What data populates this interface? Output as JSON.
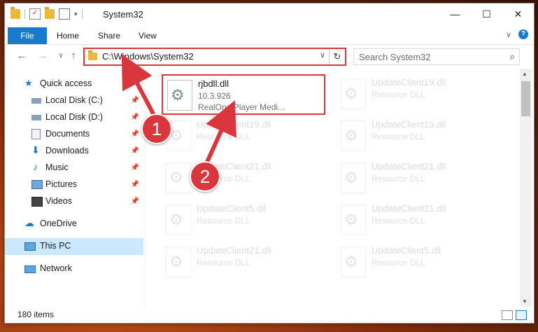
{
  "window": {
    "title": "System32",
    "minimize_glyph": "—",
    "maximize_glyph": "☐",
    "close_glyph": "✕"
  },
  "ribbon": {
    "tabs": [
      "File",
      "Home",
      "Share",
      "View"
    ],
    "expand_glyph": "∨",
    "help_glyph": "?"
  },
  "navigation": {
    "back_glyph": "←",
    "forward_glyph": "→",
    "recent_glyph": "∨",
    "up_glyph": "↑",
    "address": "C:\\Windows\\System32",
    "dropdown_glyph": "∨",
    "refresh_glyph": "↻",
    "search_placeholder": "Search System32",
    "search_glyph": "⌕"
  },
  "sidebar": {
    "items": [
      {
        "label": "Quick access",
        "icon": "star-icon",
        "pinned": false
      },
      {
        "label": "Local Disk (C:)",
        "icon": "drive-icon",
        "pinned": true
      },
      {
        "label": "Local Disk (D:)",
        "icon": "drive-icon",
        "pinned": true
      },
      {
        "label": "Documents",
        "icon": "documents-icon",
        "pinned": true
      },
      {
        "label": "Downloads",
        "icon": "download-icon",
        "pinned": true
      },
      {
        "label": "Music",
        "icon": "music-icon",
        "pinned": true
      },
      {
        "label": "Pictures",
        "icon": "pictures-icon",
        "pinned": true
      },
      {
        "label": "Videos",
        "icon": "videos-icon",
        "pinned": true
      },
      {
        "label": "OneDrive",
        "icon": "cloud-icon",
        "pinned": false
      },
      {
        "label": "This PC",
        "icon": "computer-icon",
        "pinned": false,
        "selected": true
      },
      {
        "label": "Network",
        "icon": "network-icon",
        "pinned": false
      }
    ],
    "pin_glyph": "📌"
  },
  "files": {
    "selected": {
      "name": "rjbdll.dll",
      "version": "10.3.926",
      "description": "RealOne Player Medi..."
    },
    "faded": [
      {
        "name": "UpdateClient19.dll",
        "type": "Resource DLL"
      },
      {
        "name": "UpdateClient19.dll",
        "type": "Resource DLL"
      },
      {
        "name": "UpdateClient19.dll",
        "type": "Resource DLL"
      },
      {
        "name": "UpdateClient21.dll",
        "type": "Resource DLL"
      },
      {
        "name": "UpdateClient21.dll",
        "type": "Resource DLL"
      },
      {
        "name": "UpdateClient5.dll",
        "type": "Resource DLL"
      },
      {
        "name": "UpdateClient21.dll",
        "type": "Resource DLL"
      },
      {
        "name": "UpdateClient21.dll",
        "type": "Resource DLL"
      },
      {
        "name": "UpdateClient5.dll",
        "type": "Resource DLL"
      }
    ]
  },
  "status": {
    "items_count": "180 items"
  },
  "annotations": [
    {
      "label": "1",
      "color": "#d9363e"
    },
    {
      "label": "2",
      "color": "#d9363e"
    }
  ],
  "colors": {
    "accent": "#1979ca",
    "highlight": "#d9363e",
    "selection": "#cce8ff"
  }
}
